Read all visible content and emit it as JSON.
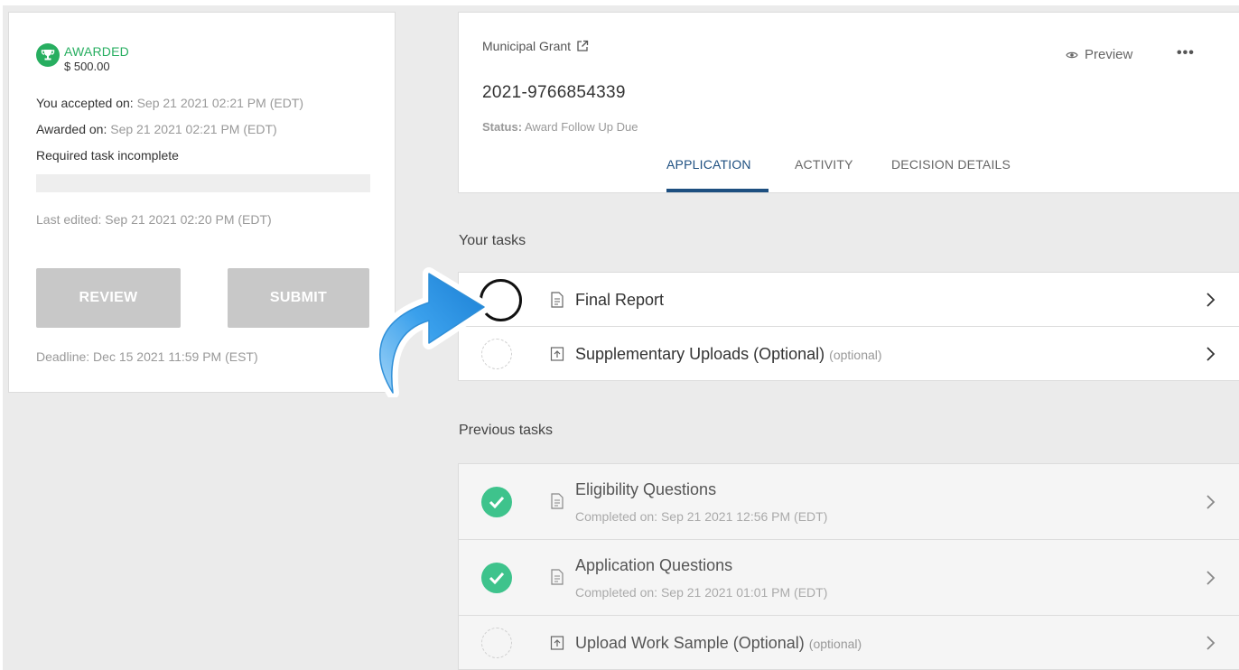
{
  "award": {
    "status": "AWARDED",
    "amount": "$ 500.00",
    "accepted_label": "You accepted on: ",
    "accepted_value": "Sep 21 2021 02:21 PM (EDT)",
    "awarded_label": "Awarded on: ",
    "awarded_value": "Sep 21 2021 02:21 PM (EDT)",
    "task_notice": "Required task incomplete",
    "progress": 0,
    "last_edited": "Last edited: Sep 21 2021 02:20 PM (EDT)",
    "review_label": "REVIEW",
    "submit_label": "SUBMIT",
    "deadline": "Deadline: Dec 15 2021 11:59 PM (EST)",
    "accent_color": "#27ae60"
  },
  "header": {
    "grant_name": "Municipal Grant",
    "application_id": "2021-9766854339",
    "status_label": "Status:",
    "status_value": "Award Follow Up Due",
    "preview_label": "Preview",
    "more_label": "•••",
    "tabs": [
      {
        "label": "APPLICATION",
        "active": true
      },
      {
        "label": "ACTIVITY",
        "active": false
      },
      {
        "label": "DECISION DETAILS",
        "active": false
      }
    ],
    "accent_color": "#1d4f80"
  },
  "your_tasks": {
    "title": "Your tasks",
    "items": [
      {
        "label": "Final Report",
        "optional_tag": "",
        "icon": "document-icon",
        "state": "incomplete-highlighted"
      },
      {
        "label": "Supplementary Uploads (Optional)",
        "optional_tag": "(optional)",
        "icon": "upload-icon",
        "state": "not-started"
      }
    ]
  },
  "previous_tasks": {
    "title": "Previous tasks",
    "items": [
      {
        "label": "Eligibility Questions",
        "completed": "Completed on: Sep 21 2021 12:56 PM (EDT)",
        "icon": "document-icon",
        "state": "complete"
      },
      {
        "label": "Application Questions",
        "completed": "Completed on: Sep 21 2021 01:01 PM (EDT)",
        "icon": "document-icon",
        "state": "complete"
      },
      {
        "label": "Upload Work Sample (Optional)",
        "optional_tag": "(optional)",
        "icon": "upload-icon",
        "state": "not-started"
      }
    ]
  }
}
